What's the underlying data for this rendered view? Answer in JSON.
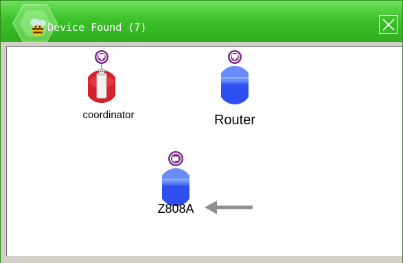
{
  "window": {
    "title": "Device Found (7)",
    "close_icon": "close-icon",
    "accent_color": "#3dc12a"
  },
  "network": {
    "nodes": [
      {
        "id": "coordinator",
        "label": "coordinator",
        "type": "coordinator",
        "status_icon": "monitor-icon",
        "color": "#d8202a"
      },
      {
        "id": "router",
        "label": "Router",
        "type": "router",
        "status_icon": "monitor-icon",
        "color": "#2f55f0"
      },
      {
        "id": "z808a",
        "label": "Z808A",
        "type": "end-device",
        "status_icon": "device-icon",
        "color": "#2f55f0"
      }
    ],
    "indicator": "arrow-left-icon"
  }
}
